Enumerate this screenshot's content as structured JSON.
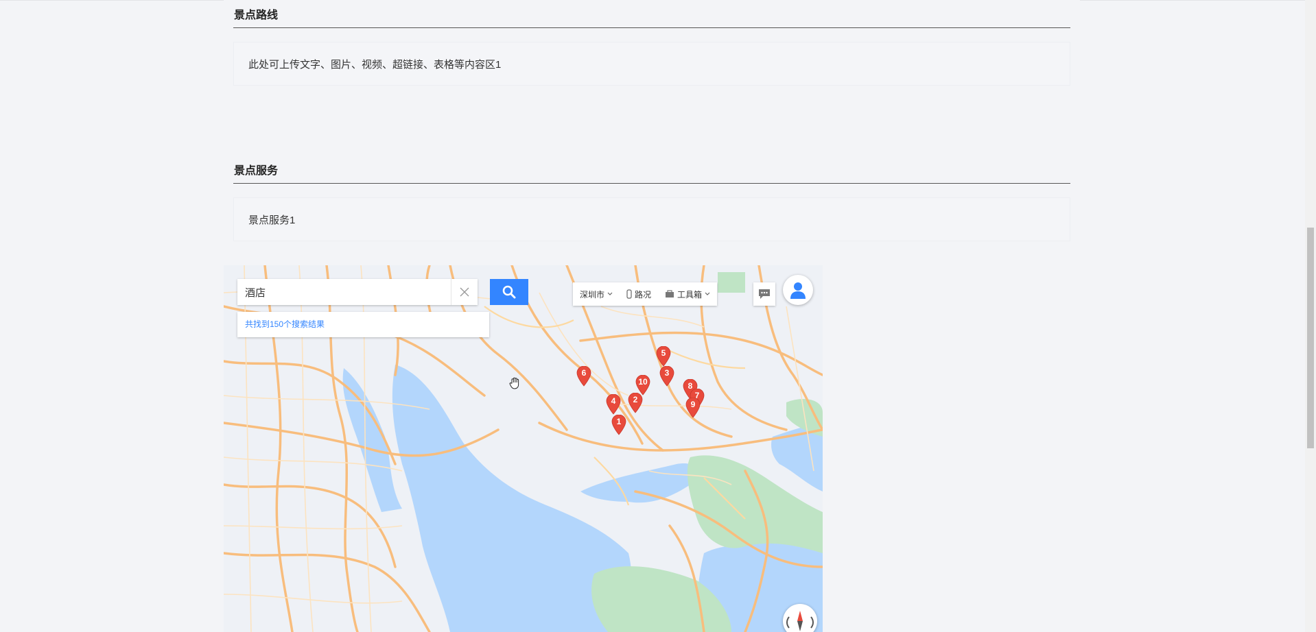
{
  "sections": {
    "route": {
      "title": "景点路线",
      "content": "此处可上传文字、图片、视频、超链接、表格等内容区1"
    },
    "service": {
      "title": "景点服务",
      "content": "景点服务1"
    }
  },
  "map": {
    "search": {
      "value": "酒店"
    },
    "result_text": "共找到150个搜索结果",
    "toolbar": {
      "city_label": "深圳市",
      "traffic_label": "路况",
      "toolbox_label": "工具箱"
    },
    "markers": [
      "1",
      "2",
      "3",
      "4",
      "5",
      "6",
      "7",
      "8",
      "9",
      "10"
    ],
    "colors": {
      "marker": "#e84a3c",
      "search_button": "#3385ff",
      "water": "#b3d6fc",
      "land": "#eef1f6",
      "road": "#f8bd7d",
      "green": "#bfe4c5"
    }
  }
}
